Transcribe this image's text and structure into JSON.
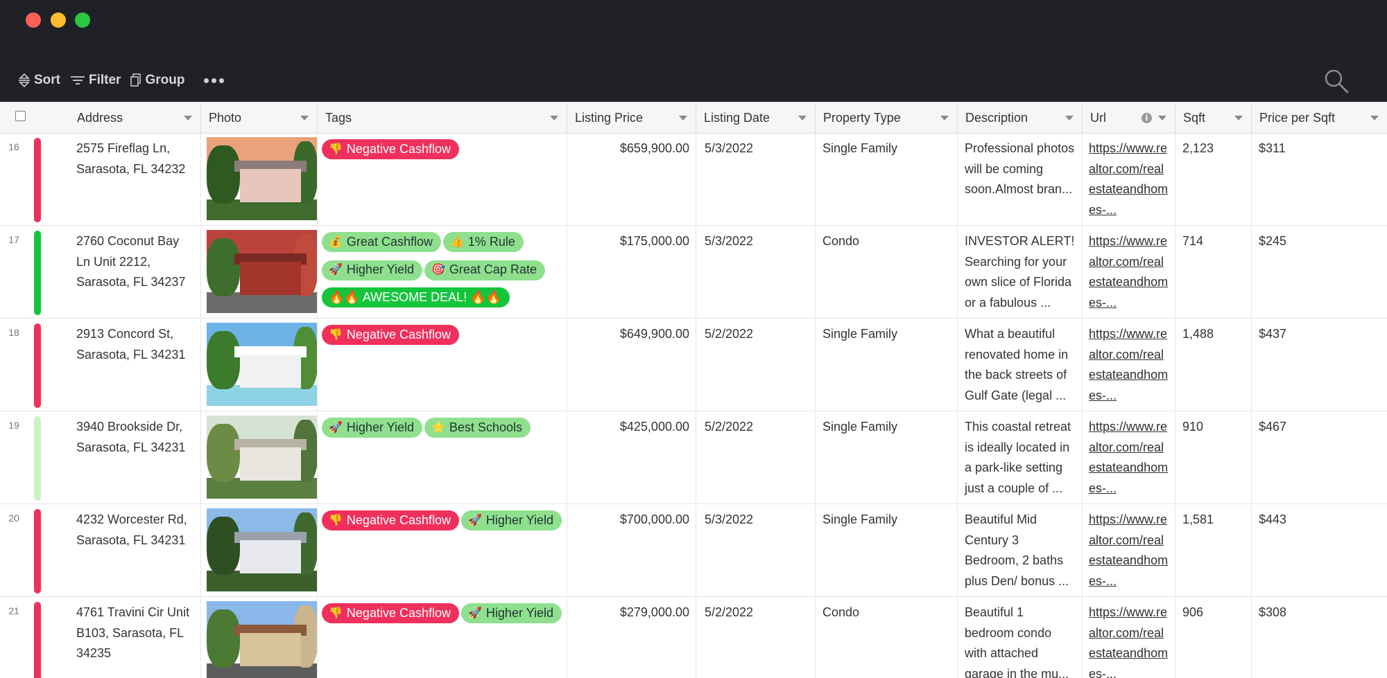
{
  "toolbar": {
    "sort_label": "Sort",
    "filter_label": "Filter",
    "group_label": "Group"
  },
  "columns": [
    {
      "key": "address",
      "label": "Address"
    },
    {
      "key": "photo",
      "label": "Photo"
    },
    {
      "key": "tags",
      "label": "Tags"
    },
    {
      "key": "price",
      "label": "Listing Price"
    },
    {
      "key": "date",
      "label": "Listing Date"
    },
    {
      "key": "type",
      "label": "Property Type"
    },
    {
      "key": "desc",
      "label": "Description"
    },
    {
      "key": "url",
      "label": "Url"
    },
    {
      "key": "sqft",
      "label": "Sqft"
    },
    {
      "key": "ppsf",
      "label": "Price per Sqft"
    }
  ],
  "colors": {
    "negative_bar": "#f0305c",
    "good_bar": "#14c53c",
    "light_bar": "#c9f2c4"
  },
  "rows": [
    {
      "num": "16",
      "status_color": "#f0305c",
      "address": "2575 Fireflag Ln, Sarasota, FL 34232",
      "photo_icon": "house-photo",
      "tags": [
        {
          "label": "Negative Cashflow",
          "icon": "👎",
          "style": "neg"
        }
      ],
      "price": "$659,900.00",
      "date": "5/3/2022",
      "type": "Single Family",
      "desc": "Professional photos will be coming soon.Almost bran...",
      "url": "https://www.realtor.com/realestateandhomes-...",
      "sqft": "2,123",
      "ppsf": "$311"
    },
    {
      "num": "17",
      "status_color": "#14c53c",
      "address": "2760 Coconut Bay Ln Unit 2212, Sarasota, FL 34237",
      "photo_icon": "condo-photo",
      "tags": [
        {
          "label": "Great Cashflow",
          "icon": "💰",
          "style": "pos"
        },
        {
          "label": "1% Rule",
          "icon": "👍",
          "style": "pos"
        },
        {
          "label": "Higher Yield",
          "icon": "🚀",
          "style": "pos"
        },
        {
          "label": "Great Cap Rate",
          "icon": "🎯",
          "style": "pos"
        },
        {
          "label": "🔥🔥 AWESOME DEAL! 🔥🔥",
          "icon": "",
          "style": "awesome"
        }
      ],
      "price": "$175,000.00",
      "date": "5/3/2022",
      "type": "Condo",
      "desc": "INVESTOR ALERT! Searching for your own slice of Florida or a fabulous ...",
      "url": "https://www.realtor.com/realestateandhomes-...",
      "sqft": "714",
      "ppsf": "$245"
    },
    {
      "num": "18",
      "status_color": "#f0305c",
      "address": "2913 Concord St, Sarasota, FL 34231",
      "photo_icon": "pool-photo",
      "tags": [
        {
          "label": "Negative Cashflow",
          "icon": "👎",
          "style": "neg"
        }
      ],
      "price": "$649,900.00",
      "date": "5/2/2022",
      "type": "Single Family",
      "desc": "What a beautiful renovated home in the back streets of Gulf Gate (legal ...",
      "url": "https://www.realtor.com/realestateandhomes-...",
      "sqft": "1,488",
      "ppsf": "$437"
    },
    {
      "num": "19",
      "status_color": "#c9f2c4",
      "address": "3940 Brookside Dr, Sarasota, FL 34231",
      "photo_icon": "house-photo",
      "tags": [
        {
          "label": "Higher Yield",
          "icon": "🚀",
          "style": "pos"
        },
        {
          "label": "Best Schools",
          "icon": "⭐",
          "style": "pos"
        }
      ],
      "price": "$425,000.00",
      "date": "5/2/2022",
      "type": "Single Family",
      "desc": "This coastal retreat is ideally located in a park-like setting just a couple of ...",
      "url": "https://www.realtor.com/realestateandhomes-...",
      "sqft": "910",
      "ppsf": "$467"
    },
    {
      "num": "20",
      "status_color": "#f0305c",
      "address": "4232 Worcester Rd, Sarasota, FL 34231",
      "photo_icon": "house-photo",
      "tags": [
        {
          "label": "Negative Cashflow",
          "icon": "👎",
          "style": "neg"
        },
        {
          "label": "Higher Yield",
          "icon": "🚀",
          "style": "pos"
        }
      ],
      "price": "$700,000.00",
      "date": "5/3/2022",
      "type": "Single Family",
      "desc": "Beautiful Mid Century 3 Bedroom, 2 baths plus Den/ bonus ...",
      "url": "https://www.realtor.com/realestateandhomes-...",
      "sqft": "1,581",
      "ppsf": "$443"
    },
    {
      "num": "21",
      "status_color": "#f0305c",
      "address": "4761 Travini Cir Unit B103, Sarasota, FL 34235",
      "photo_icon": "condo-photo",
      "tags": [
        {
          "label": "Negative Cashflow",
          "icon": "👎",
          "style": "neg"
        },
        {
          "label": "Higher Yield",
          "icon": "🚀",
          "style": "pos"
        }
      ],
      "price": "$279,000.00",
      "date": "5/2/2022",
      "type": "Condo",
      "desc": "Beautiful 1 bedroom condo with attached garage in the mu...",
      "url": "https://www.realtor.com/realestateandhomes-...",
      "sqft": "906",
      "ppsf": "$308"
    }
  ]
}
